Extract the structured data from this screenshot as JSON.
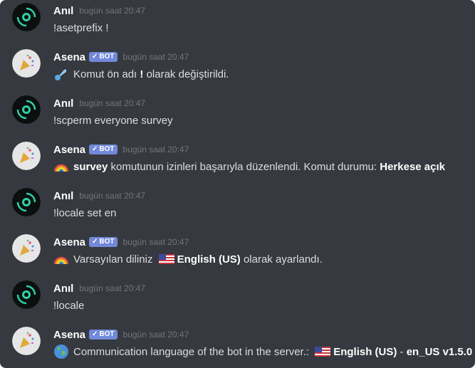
{
  "messages": [
    {
      "author": "Anıl",
      "bot": false,
      "time": "bugün saat 20:47",
      "text": "!asetprefix !"
    },
    {
      "author": "Asena",
      "bot": true,
      "time": "bugün saat 20:47",
      "emoji": "comet",
      "parts": [
        "Komut ön adı ",
        "!",
        " olarak değiştirildi."
      ]
    },
    {
      "author": "Anıl",
      "bot": false,
      "time": "bugün saat 20:47",
      "text": "!scperm everyone survey"
    },
    {
      "author": "Asena",
      "bot": true,
      "time": "bugün saat 20:47",
      "emoji": "rainbow",
      "parts": [
        "survey",
        " komutunun izinleri başarıyla düzenlendi. Komut durumu: ",
        "Herkese açık"
      ]
    },
    {
      "author": "Anıl",
      "bot": false,
      "time": "bugün saat 20:47",
      "text": "!locale set en"
    },
    {
      "author": "Asena",
      "bot": true,
      "time": "bugün saat 20:47",
      "emoji": "rainbow",
      "parts": [
        "Varsayılan diliniz ",
        "English (US)",
        " olarak ayarlandı."
      ]
    },
    {
      "author": "Anıl",
      "bot": false,
      "time": "bugün saat 20:47",
      "text": "!locale"
    },
    {
      "author": "Asena",
      "bot": true,
      "time": "bugün saat 20:47",
      "emoji": "globe",
      "parts": [
        "Communication language of the bot in the server.: ",
        "English (US)",
        " - ",
        "en_US v1.5.0"
      ]
    }
  ],
  "bot_tag": {
    "check": "✓",
    "label": "BOT"
  },
  "colors": {
    "background": "#36393f",
    "bot_tag": "#7289da",
    "username": "#ffffff",
    "text": "#dcddde",
    "timestamp": "#72767d"
  },
  "icons": {
    "user_avatar": "circular-arrows-avatar-icon",
    "bot_avatar": "party-popper-avatar-icon",
    "flag": "us-flag-icon"
  }
}
